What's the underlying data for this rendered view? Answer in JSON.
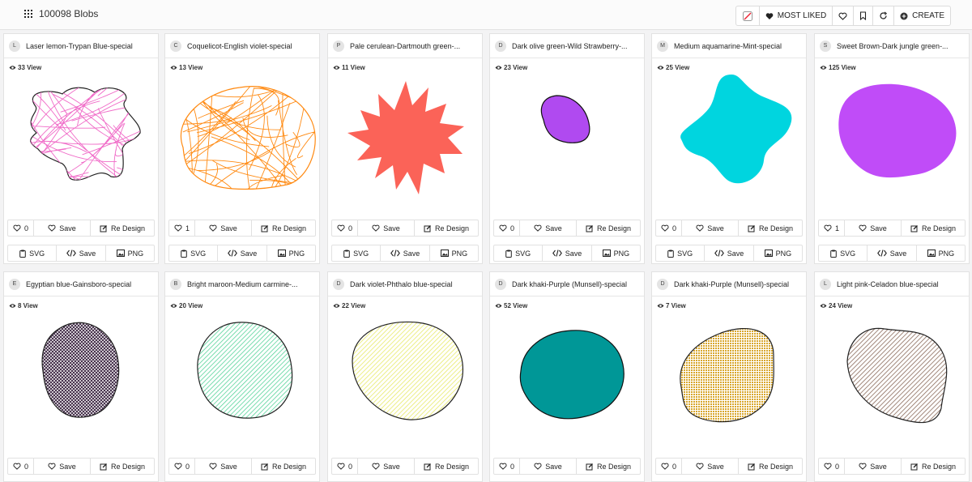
{
  "header": {
    "count_label": "100098 Blobs",
    "buttons": {
      "most_liked": "MOST LIKED",
      "create": "CREATE"
    }
  },
  "labels": {
    "save": "Save",
    "redesign": "Re Design",
    "svg": "SVG",
    "png": "PNG"
  },
  "cards": [
    {
      "initial": "L",
      "title": "Laser lemon-Trypan Blue-special",
      "views": "33 View",
      "likes": "0",
      "fill": "#f06cc8",
      "stroke": "#222222",
      "style": "scribble"
    },
    {
      "initial": "C",
      "title": "Coquelicot-English violet-special",
      "views": "13 View",
      "likes": "1",
      "fill": "#ff8a12",
      "stroke": "#ff8a12",
      "style": "scribble"
    },
    {
      "initial": "P",
      "title": "Pale cerulean-Dartmouth green-...",
      "views": "11 View",
      "likes": "0",
      "fill": "#fb6358",
      "stroke": "none",
      "style": "solid"
    },
    {
      "initial": "D",
      "title": "Dark olive green-Wild Strawberry-...",
      "views": "23 View",
      "likes": "0",
      "fill": "#b04af0",
      "stroke": "#111111",
      "style": "solid"
    },
    {
      "initial": "M",
      "title": "Medium aquamarine-Mint-special",
      "views": "25 View",
      "likes": "0",
      "fill": "#00d5df",
      "stroke": "none",
      "style": "solid"
    },
    {
      "initial": "S",
      "title": "Sweet Brown-Dark jungle green-...",
      "views": "125 View",
      "likes": "1",
      "fill": "#c04cf8",
      "stroke": "none",
      "style": "solid"
    },
    {
      "initial": "E",
      "title": "Egyptian blue-Gainsboro-special",
      "views": "8 View",
      "likes": "0",
      "fill": "#3a2340",
      "stroke": "#222222",
      "style": "crosshatch"
    },
    {
      "initial": "B",
      "title": "Bright maroon-Medium carmine-...",
      "views": "20 View",
      "likes": "0",
      "fill": "#56d39a",
      "stroke": "#222222",
      "style": "hatch"
    },
    {
      "initial": "D",
      "title": "Dark violet-Phthalo blue-special",
      "views": "22 View",
      "likes": "0",
      "fill": "#e8ea6a",
      "stroke": "#222222",
      "style": "hatch"
    },
    {
      "initial": "D",
      "title": "Dark khaki-Purple (Munsell)-special",
      "views": "52 View",
      "likes": "0",
      "fill": "#009797",
      "stroke": "#111111",
      "style": "solid"
    },
    {
      "initial": "D",
      "title": "Dark khaki-Purple (Munsell)-special",
      "views": "7 View",
      "likes": "0",
      "fill": "#d8a62c",
      "stroke": "#222222",
      "style": "dots"
    },
    {
      "initial": "L",
      "title": "Light pink-Celadon blue-special",
      "views": "24 View",
      "likes": "0",
      "fill": "#8a6a5a",
      "stroke": "#222222",
      "style": "hatch"
    }
  ]
}
